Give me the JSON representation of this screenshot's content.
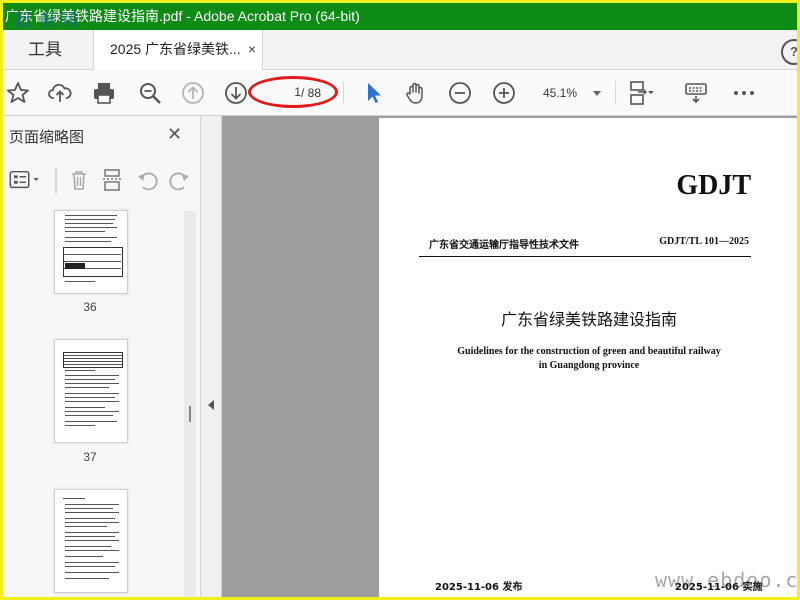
{
  "window": {
    "title": "广东省绿美铁路建设指南.pdf - Adobe Acrobat Pro (64-bit)"
  },
  "tabs": {
    "tools_label": "工具",
    "doc_label": "2025 广东省绿美铁...",
    "close_glyph": "×",
    "help_glyph": "?"
  },
  "toolbar": {
    "page_current": "1",
    "page_total": "/ 88",
    "zoom": "45.1%"
  },
  "sidebar": {
    "title": "页面缩略图",
    "close_glyph": "✕",
    "thumbnails": [
      {
        "number": "36"
      },
      {
        "number": "37"
      },
      {
        "number": ""
      }
    ]
  },
  "document": {
    "logo": "GDJT",
    "department": "广东省交通运输厅指导性技术文件",
    "code": "GDJT/TL 101—2025",
    "title_cn": "广东省绿美铁路建设指南",
    "title_en_line1": "Guidelines for the construction of green and beautiful railway",
    "title_en_line2": "in Guangdong province",
    "published": "2025-11-06 发布",
    "implemented": "2025-11-06 实施"
  },
  "watermarks": {
    "top_left": "起 标网",
    "bottom_right": "www.ebdoo.com"
  },
  "colors": {
    "titlebar": "#0d8b14",
    "annotation_ellipse": "#e21b1b",
    "frame_border": "#f2ef1a",
    "select_tool": "#2d6fd6"
  }
}
